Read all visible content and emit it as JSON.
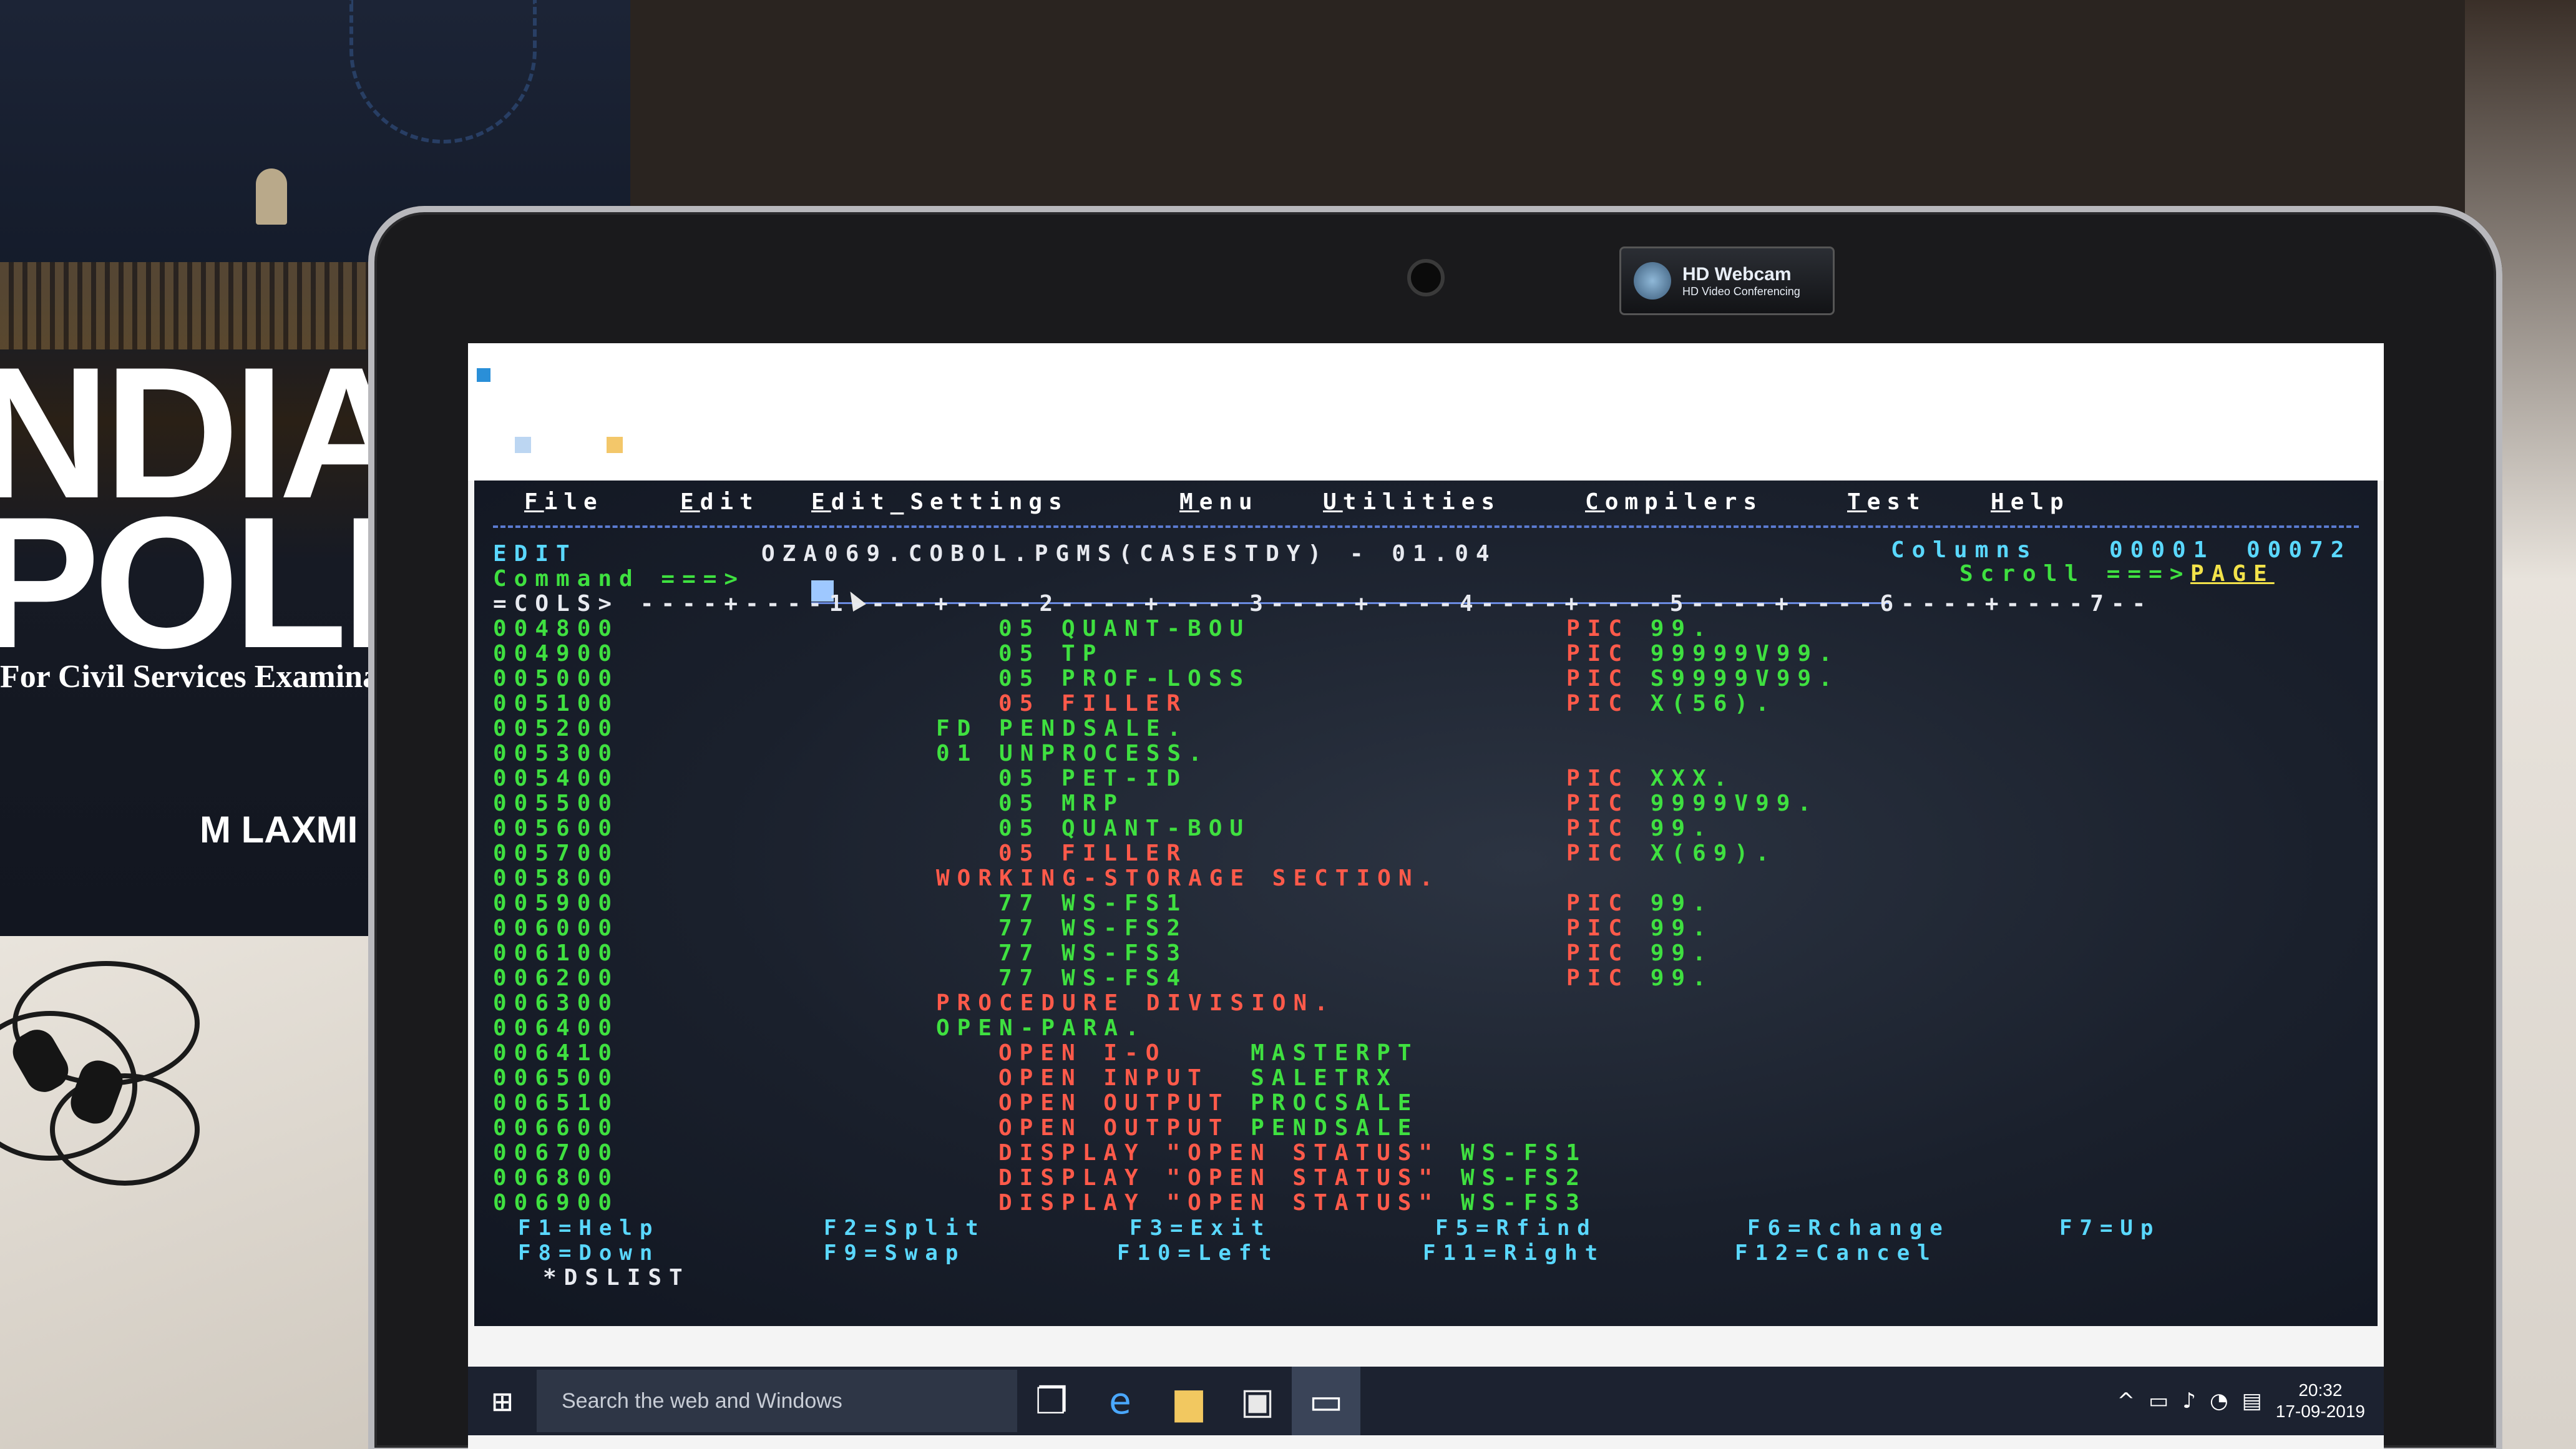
{
  "book": {
    "title_line1": "NDIA",
    "title_line2": "POLIT",
    "subtitle": "For Civil Services Examinati",
    "author": "M LAXMI"
  },
  "webcam_sticker": {
    "line1": "HD Webcam",
    "line2": "HD Video Conferencing"
  },
  "ispf": {
    "menu": [
      {
        "hot": "F",
        "rest": "ile"
      },
      {
        "hot": "E",
        "rest": "dit"
      },
      {
        "hot": "E",
        "rest": "dit_Settings"
      },
      {
        "hot": "M",
        "rest": "enu"
      },
      {
        "hot": "U",
        "rest": "tilities"
      },
      {
        "hot": "C",
        "rest": "ompilers"
      },
      {
        "hot": "T",
        "rest": "est"
      },
      {
        "hot": "H",
        "rest": "elp"
      }
    ],
    "mode": "EDIT",
    "dataset": "OZA069.COBOL.PGMS(CASESTDY) - 01.04",
    "columns_label": "Columns",
    "columns_from": "00001",
    "columns_to": "00072",
    "command_label": "Command ===>",
    "command_value": "",
    "scroll_label": "Scroll ===>",
    "scroll_value": "PAGE",
    "ruler": "=COLS> ----+----1----+----2----+----3----+----4----+----5----+----6----+----7--",
    "lines": [
      {
        "seq": "004800",
        "code": "05 QUANT-BOU",
        "pic": "PIC 99."
      },
      {
        "seq": "004900",
        "code": "05 TP",
        "pic": "PIC 99999V99."
      },
      {
        "seq": "005000",
        "code": "05 PROF-LOSS",
        "pic": "PIC S9999V99."
      },
      {
        "seq": "005100",
        "code": "05 FILLER",
        "pic": "PIC X(56)."
      },
      {
        "seq": "005200",
        "code": "FD PENDSALE.",
        "pic": ""
      },
      {
        "seq": "005300",
        "code": "01 UNPROCESS.",
        "pic": ""
      },
      {
        "seq": "005400",
        "code": "05 PET-ID",
        "pic": "PIC XXX."
      },
      {
        "seq": "005500",
        "code": "05 MRP",
        "pic": "PIC 9999V99."
      },
      {
        "seq": "005600",
        "code": "05 QUANT-BOU",
        "pic": "PIC 99."
      },
      {
        "seq": "005700",
        "code": "05 FILLER",
        "pic": "PIC X(69)."
      },
      {
        "seq": "005800",
        "code": "WORKING-STORAGE SECTION.",
        "pic": ""
      },
      {
        "seq": "005900",
        "code": "77 WS-FS1",
        "pic": "PIC 99."
      },
      {
        "seq": "006000",
        "code": "77 WS-FS2",
        "pic": "PIC 99."
      },
      {
        "seq": "006100",
        "code": "77 WS-FS3",
        "pic": "PIC 99."
      },
      {
        "seq": "006200",
        "code": "77 WS-FS4",
        "pic": "PIC 99."
      },
      {
        "seq": "006300",
        "code": "PROCEDURE DIVISION.",
        "pic": ""
      },
      {
        "seq": "006400",
        "code": "OPEN-PARA.",
        "pic": ""
      },
      {
        "seq": "006410",
        "code": "OPEN I-O    MASTERPT",
        "pic": ""
      },
      {
        "seq": "006500",
        "code": "OPEN INPUT  SALETRX",
        "pic": ""
      },
      {
        "seq": "006510",
        "code": "OPEN OUTPUT PROCSALE",
        "pic": ""
      },
      {
        "seq": "006600",
        "code": "OPEN OUTPUT PENDSALE",
        "pic": ""
      },
      {
        "seq": "006700",
        "code": "DISPLAY \"OPEN STATUS\" WS-FS1",
        "pic": ""
      },
      {
        "seq": "006800",
        "code": "DISPLAY \"OPEN STATUS\" WS-FS2",
        "pic": ""
      },
      {
        "seq": "006900",
        "code": "DISPLAY \"OPEN STATUS\" WS-FS3",
        "pic": ""
      }
    ],
    "fkeys_row1": [
      "F1=Help",
      "F2=Split",
      "F3=Exit",
      "F5=Rfind",
      "F6=Rchange",
      "F7=Up"
    ],
    "fkeys_row2": [
      "F8=Down",
      "F9=Swap",
      "F10=Left",
      "F11=Right",
      "F12=Cancel"
    ],
    "dslist": "*DSLIST"
  },
  "taskbar": {
    "search_placeholder": "Search the web and Windows",
    "time": "20:32",
    "date": "17-09-2019",
    "icons": [
      "task-view-icon",
      "edge-icon",
      "file-explorer-icon",
      "store-icon",
      "terminal-app-icon"
    ]
  }
}
